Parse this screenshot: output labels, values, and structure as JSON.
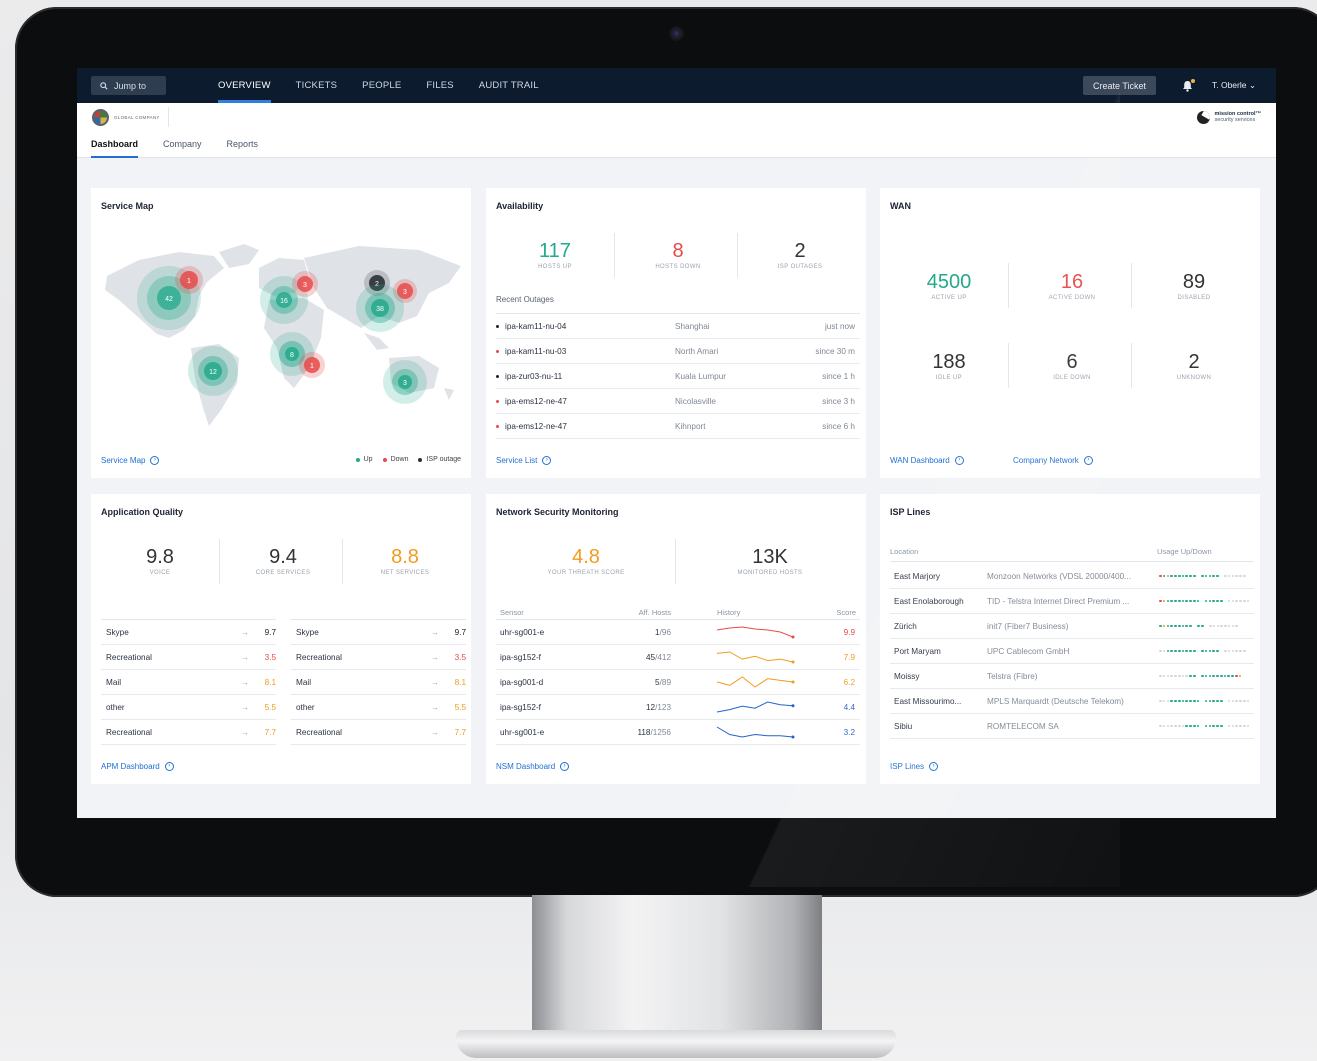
{
  "topnav": {
    "jump_to": "Jump to",
    "links": [
      "OVERVIEW",
      "TICKETS",
      "PEOPLE",
      "FILES",
      "AUDIT TRAIL"
    ],
    "active_link": "OVERVIEW",
    "create_ticket": "Create Ticket",
    "user": "T. Oberle"
  },
  "brand": {
    "company": "GLOBAL COMPANY",
    "product_line1": "mission control™",
    "product_line2": "security services"
  },
  "subtabs": {
    "items": [
      "Dashboard",
      "Company",
      "Reports"
    ],
    "active": "Dashboard"
  },
  "service_map": {
    "title": "Service Map",
    "link": "Service Map",
    "legend": {
      "up": "Up",
      "down": "Down",
      "isp": "ISP outage"
    },
    "clusters": [
      {
        "label": "42",
        "status": "up"
      },
      {
        "label": "1",
        "status": "down"
      },
      {
        "label": "16",
        "status": "up"
      },
      {
        "label": "3",
        "status": "down"
      },
      {
        "label": "2",
        "status": "isp"
      },
      {
        "label": "3",
        "status": "down"
      },
      {
        "label": "38",
        "status": "up"
      },
      {
        "label": "8",
        "status": "up"
      },
      {
        "label": "1",
        "status": "down"
      },
      {
        "label": "12",
        "status": "up"
      },
      {
        "label": "3",
        "status": "up"
      }
    ]
  },
  "availability": {
    "title": "Availability",
    "stats": [
      {
        "value": "117",
        "label": "HOSTS UP"
      },
      {
        "value": "8",
        "label": "HOSTS DOWN"
      },
      {
        "value": "2",
        "label": "ISP OUTAGES"
      }
    ],
    "recent_title": "Recent Outages",
    "outages": [
      {
        "host": "ipa-kam11-nu-04",
        "location": "Shanghai",
        "since": "just now",
        "status": "isp"
      },
      {
        "host": "ipa-kam11-nu-03",
        "location": "North Amari",
        "since": "since 30 m",
        "status": "down"
      },
      {
        "host": "ipa-zur03-nu-11",
        "location": "Kuala Lumpur",
        "since": "since 1 h",
        "status": "isp"
      },
      {
        "host": "ipa-ems12-ne-47",
        "location": "Nicolasville",
        "since": "since 3 h",
        "status": "down"
      },
      {
        "host": "ipa-ems12-ne-47",
        "location": "Kihnport",
        "since": "since 6 h",
        "status": "down"
      }
    ],
    "link": "Service List"
  },
  "wan": {
    "title": "WAN",
    "stats": [
      {
        "value": "4500",
        "label": "ACTIVE UP"
      },
      {
        "value": "16",
        "label": "ACTIVE DOWN"
      },
      {
        "value": "89",
        "label": "DISABLED"
      },
      {
        "value": "188",
        "label": "IDLE UP"
      },
      {
        "value": "6",
        "label": "IDLE DOWN"
      },
      {
        "value": "2",
        "label": "UNKNOWN"
      }
    ],
    "link1": "WAN Dashboard",
    "link2": "Company Network"
  },
  "app_quality": {
    "title": "Application Quality",
    "stats": [
      {
        "value": "9.8",
        "label": "VOICE"
      },
      {
        "value": "9.4",
        "label": "CORE SERVICES"
      },
      {
        "value": "8.8",
        "label": "NET SERVICES"
      }
    ],
    "left": [
      {
        "name": "Skype",
        "score": "9.7"
      },
      {
        "name": "Recreational",
        "score": "3.5"
      },
      {
        "name": "Mail",
        "score": "8.1"
      },
      {
        "name": "other",
        "score": "5.5"
      },
      {
        "name": "Recreational",
        "score": "7.7"
      }
    ],
    "right": [
      {
        "name": "Skype",
        "score": "9.7"
      },
      {
        "name": "Recreational",
        "score": "3.5"
      },
      {
        "name": "Mail",
        "score": "8.1"
      },
      {
        "name": "other",
        "score": "5.5"
      },
      {
        "name": "Recreational",
        "score": "7.7"
      }
    ],
    "arrow": "→",
    "link": "APM Dashboard"
  },
  "nsm": {
    "title": "Network Security Monitoring",
    "stats": [
      {
        "value": "4.8",
        "label": "YOUR THREATH SCORE"
      },
      {
        "value": "13K",
        "label": "MONITORED HOSTS"
      }
    ],
    "headers": {
      "sensor": "Sensor",
      "aff": "Aff. Hosts",
      "history": "History",
      "score": "Score"
    },
    "rows": [
      {
        "sensor": "uhr-sg001-e",
        "aff": "1",
        "total": "/96",
        "score": "9.9",
        "trend": [
          3,
          3.4,
          3.6,
          3.2,
          3,
          2.6,
          1.6
        ],
        "color": "#e84a4a"
      },
      {
        "sensor": "ipa-sg152-f",
        "aff": "45",
        "total": "/412",
        "score": "7.9",
        "trend": [
          3,
          3.1,
          2.6,
          2.8,
          2.5,
          2.6,
          2.4
        ],
        "color": "#f29b1e"
      },
      {
        "sensor": "ipa-sg001-d",
        "aff": "5",
        "total": "/89",
        "score": "6.2",
        "trend": [
          3,
          2.8,
          3.3,
          2.7,
          3.2,
          3.1,
          3
        ],
        "color": "#f29b1e"
      },
      {
        "sensor": "ipa-sg152-f",
        "aff": "12",
        "total": "/123",
        "score": "4.4",
        "trend": [
          1.5,
          2.2,
          3.2,
          2.6,
          4.4,
          3.6,
          3.3
        ],
        "color": "#2662c9"
      },
      {
        "sensor": "uhr-sg001-e",
        "aff": "118",
        "total": "/1256",
        "score": "3.2",
        "trend": [
          3.4,
          3.1,
          3,
          3.1,
          3.05,
          3.05,
          3
        ],
        "color": "#2662c9"
      }
    ],
    "link": "NSM Dashboard"
  },
  "isp": {
    "title": "ISP Lines",
    "headers": {
      "location": "Location",
      "usage": "Usage Up/Down"
    },
    "rows": [
      {
        "location": "East Marjory",
        "provider": "Monzoon Networks (VDSL 20000/400..."
      },
      {
        "location": "East Enolaborough",
        "provider": "TID - Telstra Internet Direct Premium ..."
      },
      {
        "location": "Zürich",
        "provider": "init7 (Fiber7 Business)"
      },
      {
        "location": "Port Maryam",
        "provider": "UPC Cablecom GmbH"
      },
      {
        "location": "Moissy",
        "provider": "Telstra (Fibre)"
      },
      {
        "location": "East Missourimo...",
        "provider": "MPLS Marquardt (Deutsche Telekom)"
      },
      {
        "location": "Sibiu",
        "provider": "ROMTELECOM SA"
      }
    ],
    "link": "ISP Lines"
  },
  "colors": {
    "up": "#23a98b",
    "down": "#e84a4a",
    "isp": "#2b2f36",
    "link": "#1f6fd1",
    "orange": "#f29b1e"
  }
}
